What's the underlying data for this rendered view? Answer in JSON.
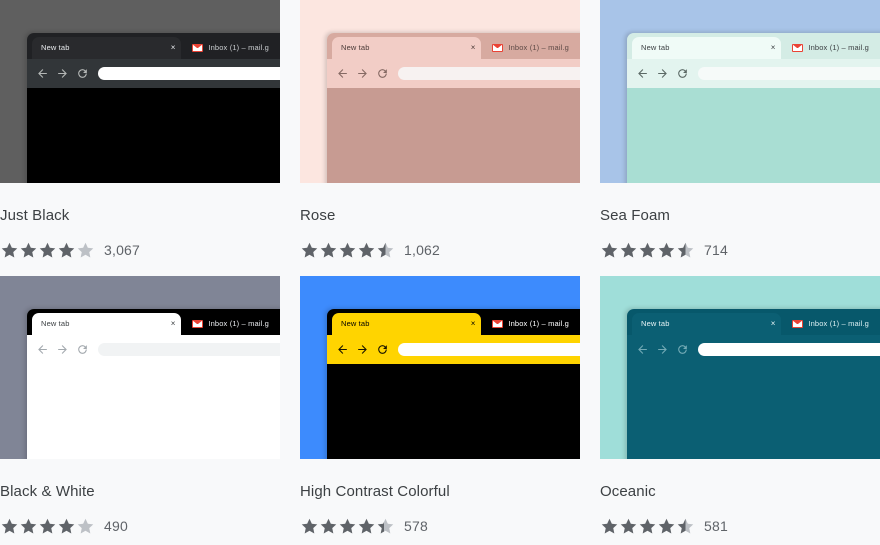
{
  "page": {
    "background": "#f8f9fa",
    "text_color": "#3c4043",
    "muted_text_color": "#5f6368",
    "star_filled_color": "#5f6368",
    "star_empty_color": "#bdc1c6"
  },
  "browser_mock": {
    "active_tab_label": "New tab",
    "close_label": "×",
    "inactive_tab_label": "Inbox (1) – mail.g",
    "inactive_tab_icon": "gmail-icon",
    "back_icon": "back-arrow-icon",
    "forward_icon": "forward-arrow-icon",
    "reload_icon": "reload-icon",
    "omnibox_value": ""
  },
  "themes": [
    {
      "name": "Just Black",
      "rating": 4.0,
      "rating_count": "3,067",
      "stars": [
        1,
        1,
        1,
        1,
        0
      ],
      "colors": {
        "frame": "#5f5f5f",
        "tabstrip": "#202124",
        "active_tab": "#292a2d",
        "active_tab_text": "#e8eaed",
        "inactive_tab_text": "#c9cccf",
        "toolbar": "#323639",
        "toolbar_icon": "#c4c7c5",
        "omnibox": "#ffffff",
        "page": "#000000"
      }
    },
    {
      "name": "Rose",
      "rating": 4.5,
      "rating_count": "1,062",
      "stars": [
        1,
        1,
        1,
        1,
        0.5
      ],
      "colors": {
        "frame": "#fce6e0",
        "tabstrip": "#d7aaa0",
        "active_tab": "#f2cdc6",
        "active_tab_text": "#4a3a37",
        "inactive_tab_text": "#5e4a46",
        "toolbar": "#f2cdc6",
        "toolbar_icon": "#7a5f59",
        "omnibox": "#f7f2f1",
        "page": "#c79b92"
      }
    },
    {
      "name": "Sea Foam",
      "rating": 4.5,
      "rating_count": "714",
      "stars": [
        1,
        1,
        1,
        1,
        0.5
      ],
      "colors": {
        "frame": "#a8c4e8",
        "tabstrip": "#d4ece5",
        "active_tab": "#f0fbf7",
        "active_tab_text": "#3c4043",
        "inactive_tab_text": "#3c4043",
        "toolbar": "#e3f4ef",
        "toolbar_icon": "#4d5b57",
        "omnibox": "#f6faf9",
        "page": "#a9ded3"
      }
    },
    {
      "name": "Black & White",
      "rating": 4.0,
      "rating_count": "490",
      "stars": [
        1,
        1,
        1,
        1,
        0
      ],
      "colors": {
        "frame": "#808596",
        "tabstrip": "#000000",
        "active_tab": "#ffffff",
        "active_tab_text": "#3c4043",
        "inactive_tab_text": "#e8eaed",
        "toolbar": "#ffffff",
        "toolbar_icon": "#9aa0a6",
        "omnibox": "#f1f3f4",
        "page": "#ffffff"
      }
    },
    {
      "name": "High Contrast Colorful",
      "rating": 4.4,
      "rating_count": "578",
      "stars": [
        1,
        1,
        1,
        1,
        0.4
      ],
      "colors": {
        "frame": "#3d8bfd",
        "tabstrip": "#000000",
        "active_tab": "#ffd400",
        "active_tab_text": "#000000",
        "inactive_tab_text": "#ffffff",
        "toolbar": "#ffd400",
        "toolbar_icon": "#000000",
        "omnibox": "#ffffff",
        "page": "#000000"
      }
    },
    {
      "name": "Oceanic",
      "rating": 4.5,
      "rating_count": "581",
      "stars": [
        1,
        1,
        1,
        1,
        0.5
      ],
      "colors": {
        "frame": "#9fded9",
        "tabstrip": "#07586b",
        "active_tab": "#0b5f73",
        "active_tab_text": "#e6f3f5",
        "inactive_tab_text": "#dbeef1",
        "toolbar": "#0b5f73",
        "toolbar_icon": "#7fb3bd",
        "omnibox": "#ffffff",
        "page": "#0b5f73"
      }
    }
  ]
}
